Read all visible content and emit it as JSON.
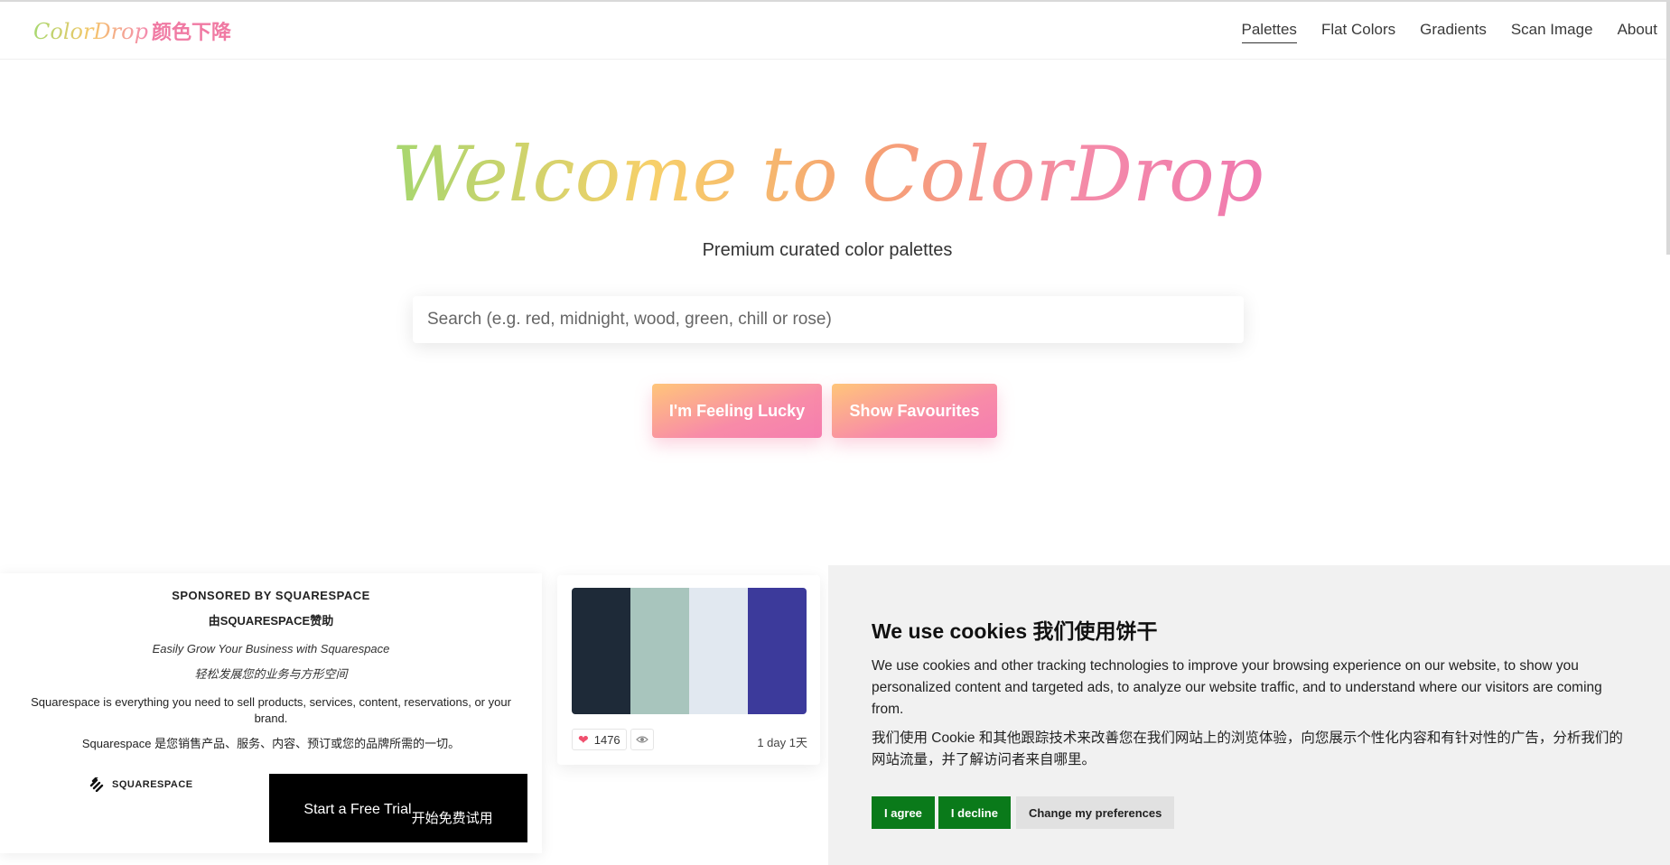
{
  "header": {
    "logo_en": "ColorDrop",
    "logo_cn": "颜色下降",
    "nav": [
      "Palettes",
      "Flat Colors",
      "Gradients",
      "Scan Image",
      "About"
    ]
  },
  "hero": {
    "title": "Welcome to ColorDrop",
    "subtitle": "Premium curated color palettes",
    "search_placeholder": "Search (e.g. red, midnight, wood, green, chill or rose)",
    "lucky_button": "I'm Feeling Lucky",
    "favourites_button": "Show Favourites"
  },
  "ad": {
    "sponsor": "SPONSORED BY SQUARESPACE",
    "sponsor_cn": "由SQUARESPACE赞助",
    "tagline": "Easily Grow Your Business with Squarespace",
    "tagline_cn": "轻松发展您的业务与方形空间",
    "desc": "Squarespace is everything you need to sell products, services, content, reservations, or your brand.",
    "desc_cn": "Squarespace 是您销售产品、服务、内容、预订或您的品牌所需的一切。",
    "brand": "SQUARESPACE",
    "cta": "Start a Free Trial",
    "cta_cn": "开始免费试用"
  },
  "palette_card": {
    "colors": [
      "#1e2a38",
      "#a8c5bd",
      "#e1e8f0",
      "#3c3a9b"
    ],
    "likes": "1476",
    "age": "1 day 1天"
  },
  "cookie": {
    "title": "We use cookies 我们使用饼干",
    "text_en": "We use cookies and other tracking technologies to improve your browsing experience on our website, to show you personalized content and targeted ads, to analyze our website traffic, and to understand where our visitors are coming from.",
    "text_cn": "我们使用 Cookie 和其他跟踪技术来改善您在我们网站上的浏览体验，向您展示个性化内容和有针对性的广告，分析我们的网站流量，并了解访问者来自哪里。",
    "agree": "I agree",
    "decline": "I decline",
    "prefs": "Change my preferences"
  }
}
